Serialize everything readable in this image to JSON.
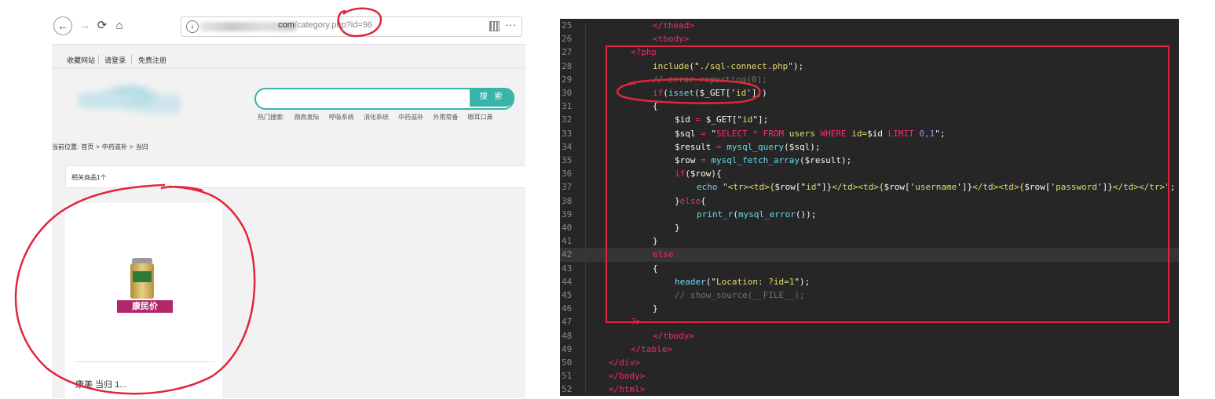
{
  "browser": {
    "nav": {
      "back": "←",
      "forward": "→",
      "reload": "⟳",
      "home": "⌂"
    },
    "url": {
      "host_suffix": "com",
      "path": "/category.php",
      "query": "?id=96"
    },
    "top_links": [
      "收藏网站",
      "请登录",
      "免费注册"
    ],
    "search": {
      "button_label": "搜 索"
    },
    "hot_words_label": "热门搜索:",
    "hot_words": [
      "颈肩发际",
      "呼吸系统",
      "消化系统",
      "中药滋补",
      "外用常备",
      "眼耳口鼻"
    ],
    "breadcrumb": [
      "当前位置:",
      "首页",
      ">",
      "中药滋补",
      ">",
      "当归"
    ],
    "related_label": "相关商品1个",
    "product": {
      "promo": "康民价",
      "name": "康美 当归 1..."
    },
    "icons": {
      "info": "info-icon",
      "qr": "qr-code-icon",
      "menu": "more-icon"
    }
  },
  "editor": {
    "lines": [
      {
        "n": "25",
        "indent": 3,
        "parts": [
          [
            "tg",
            "</"
          ],
          [
            "tg",
            "thead"
          ],
          [
            "tg",
            ">"
          ]
        ]
      },
      {
        "n": "26",
        "indent": 3,
        "parts": [
          [
            "tg",
            "<"
          ],
          [
            "tg",
            "tbody"
          ],
          [
            "tg",
            ">"
          ]
        ]
      },
      {
        "n": "27",
        "indent": 2,
        "parts": [
          [
            "tg",
            "<?php"
          ]
        ]
      },
      {
        "n": "28",
        "indent": 3,
        "parts": [
          [
            "st",
            "include"
          ],
          [
            "pl",
            "(\""
          ],
          [
            "st",
            "./sql-connect.php"
          ],
          [
            "pl",
            "\");"
          ]
        ]
      },
      {
        "n": "29",
        "indent": 3,
        "parts": [
          [
            "cm",
            "// error_reporting(0);"
          ]
        ]
      },
      {
        "n": "30",
        "indent": 3,
        "parts": [
          [
            "kw",
            "if"
          ],
          [
            "pl",
            "("
          ],
          [
            "fn",
            "isset"
          ],
          [
            "pl",
            "("
          ],
          [
            "va",
            "$_GET"
          ],
          [
            "pl",
            "['"
          ],
          [
            "st",
            "id"
          ],
          [
            "pl",
            "']))"
          ]
        ]
      },
      {
        "n": "31",
        "indent": 3,
        "parts": [
          [
            "pl",
            "{"
          ]
        ]
      },
      {
        "n": "32",
        "indent": 4,
        "parts": [
          [
            "va",
            "$id"
          ],
          [
            "op",
            " = "
          ],
          [
            "va",
            "$_GET"
          ],
          [
            "pl",
            "[\""
          ],
          [
            "st",
            "id"
          ],
          [
            "pl",
            "\"];"
          ]
        ]
      },
      {
        "n": "33",
        "indent": 4,
        "parts": [
          [
            "va",
            "$sql"
          ],
          [
            "op",
            " = "
          ],
          [
            "pl",
            "\""
          ],
          [
            "op",
            "SELECT * FROM "
          ],
          [
            "st",
            "users "
          ],
          [
            "op",
            "WHERE "
          ],
          [
            "st",
            "id="
          ],
          [
            "va",
            "$id "
          ],
          [
            "op",
            "LIMIT "
          ],
          [
            "nu",
            "0,1"
          ],
          [
            "pl",
            "\";"
          ]
        ]
      },
      {
        "n": "34",
        "indent": 4,
        "parts": [
          [
            "va",
            "$result"
          ],
          [
            "op",
            " = "
          ],
          [
            "fn",
            "mysql_query"
          ],
          [
            "pl",
            "("
          ],
          [
            "va",
            "$sql"
          ],
          [
            "pl",
            ");"
          ]
        ]
      },
      {
        "n": "35",
        "indent": 4,
        "parts": [
          [
            "va",
            "$row"
          ],
          [
            "op",
            " = "
          ],
          [
            "fn",
            "mysql_fetch_array"
          ],
          [
            "pl",
            "("
          ],
          [
            "va",
            "$result"
          ],
          [
            "pl",
            ");"
          ]
        ]
      },
      {
        "n": "36",
        "indent": 4,
        "parts": [
          [
            "kw",
            "if"
          ],
          [
            "pl",
            "("
          ],
          [
            "va",
            "$row"
          ],
          [
            "pl",
            "){"
          ]
        ]
      },
      {
        "n": "37",
        "indent": 5,
        "parts": [
          [
            "fn",
            "echo "
          ],
          [
            "st",
            "\"<tr><td>{"
          ],
          [
            "va",
            "$row"
          ],
          [
            "pl",
            "[\""
          ],
          [
            "st",
            "id"
          ],
          [
            "pl",
            "\"]}"
          ],
          [
            "st",
            "</td><td>{"
          ],
          [
            "va",
            "$row"
          ],
          [
            "pl",
            "['"
          ],
          [
            "st",
            "username"
          ],
          [
            "pl",
            "']}"
          ],
          [
            "st",
            "</td><td>{"
          ],
          [
            "va",
            "$row"
          ],
          [
            "pl",
            "['"
          ],
          [
            "st",
            "password"
          ],
          [
            "pl",
            "']}"
          ],
          [
            "st",
            "</td></tr>\""
          ],
          [
            "pl",
            ";"
          ]
        ]
      },
      {
        "n": "38",
        "indent": 4,
        "parts": [
          [
            "pl",
            "}"
          ],
          [
            "kw",
            "else"
          ],
          [
            "pl",
            "{"
          ]
        ]
      },
      {
        "n": "39",
        "indent": 5,
        "parts": [
          [
            "fn",
            "print_r"
          ],
          [
            "pl",
            "("
          ],
          [
            "fn",
            "mysql_error"
          ],
          [
            "pl",
            "());"
          ]
        ]
      },
      {
        "n": "40",
        "indent": 4,
        "parts": [
          [
            "pl",
            "}"
          ]
        ]
      },
      {
        "n": "41",
        "indent": 3,
        "parts": [
          [
            "pl",
            "}"
          ]
        ]
      },
      {
        "n": "42",
        "indent": 3,
        "parts": [
          [
            "kw",
            "else"
          ]
        ]
      },
      {
        "n": "43",
        "indent": 3,
        "parts": [
          [
            "pl",
            "{"
          ]
        ]
      },
      {
        "n": "44",
        "indent": 4,
        "parts": [
          [
            "fn",
            "header"
          ],
          [
            "pl",
            "(\""
          ],
          [
            "st",
            "Location: ?id=1"
          ],
          [
            "pl",
            "\");"
          ]
        ]
      },
      {
        "n": "45",
        "indent": 4,
        "parts": [
          [
            "cm",
            "// show_source(__FILE__);"
          ]
        ]
      },
      {
        "n": "46",
        "indent": 3,
        "parts": [
          [
            "pl",
            "}"
          ]
        ]
      },
      {
        "n": "47",
        "indent": 2,
        "parts": [
          [
            "tg",
            "?>"
          ]
        ]
      },
      {
        "n": "48",
        "indent": 3,
        "parts": [
          [
            "tg",
            "</"
          ],
          [
            "tg",
            "tbody"
          ],
          [
            "tg",
            ">"
          ]
        ]
      },
      {
        "n": "49",
        "indent": 2,
        "parts": [
          [
            "tg",
            "</"
          ],
          [
            "tg",
            "table"
          ],
          [
            "tg",
            ">"
          ]
        ]
      },
      {
        "n": "50",
        "indent": 1,
        "parts": [
          [
            "tg",
            "</"
          ],
          [
            "tg",
            "div"
          ],
          [
            "tg",
            ">"
          ]
        ]
      },
      {
        "n": "51",
        "indent": 1,
        "parts": [
          [
            "tg",
            "</"
          ],
          [
            "tg",
            "body"
          ],
          [
            "tg",
            ">"
          ]
        ]
      },
      {
        "n": "52",
        "indent": 1,
        "parts": [
          [
            "tg",
            "</"
          ],
          [
            "tg",
            "html"
          ],
          [
            "tg",
            ">"
          ]
        ]
      }
    ]
  },
  "colors": {
    "accent": "#3ab4a8",
    "annotation": "#e0263a",
    "editor_bg": "#262626",
    "promo": "#b1286a"
  }
}
